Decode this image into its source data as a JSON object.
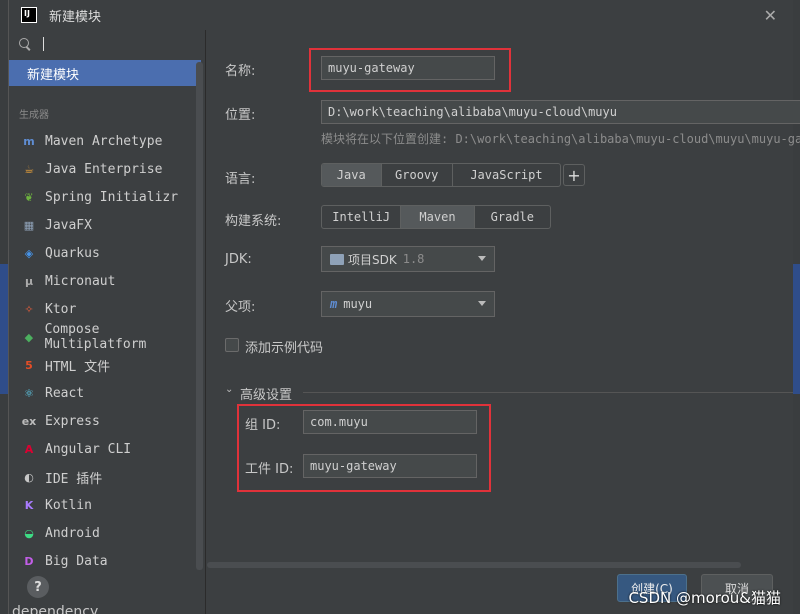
{
  "window": {
    "title": "新建模块",
    "app_icon_text": "IJ"
  },
  "sidebar": {
    "search_value": "",
    "selected": "新建模块",
    "section_label": "生成器",
    "generators": [
      {
        "label": "Maven Archetype",
        "icon": "maven-icon",
        "glyph": "m",
        "color": "#5f8dd3"
      },
      {
        "label": "Java Enterprise",
        "icon": "java-enterprise-icon",
        "glyph": "☕",
        "color": "#e8a23a"
      },
      {
        "label": "Spring Initializr",
        "icon": "spring-icon",
        "glyph": "❦",
        "color": "#6db33f"
      },
      {
        "label": "JavaFX",
        "icon": "folder-icon",
        "glyph": "▦",
        "color": "#8fa2b8"
      },
      {
        "label": "Quarkus",
        "icon": "quarkus-icon",
        "glyph": "◈",
        "color": "#4695eb"
      },
      {
        "label": "Micronaut",
        "icon": "micronaut-icon",
        "glyph": "μ",
        "color": "#aaaaaa"
      },
      {
        "label": "Ktor",
        "icon": "ktor-icon",
        "glyph": "✧",
        "color": "#e55d3b"
      },
      {
        "label": "Compose Multiplatform",
        "icon": "compose-icon",
        "glyph": "◆",
        "color": "#4cb05f"
      },
      {
        "label": "HTML 文件",
        "icon": "html5-icon",
        "glyph": "5",
        "color": "#e44d26"
      },
      {
        "label": "React",
        "icon": "react-icon",
        "glyph": "⚛",
        "color": "#61dafb"
      },
      {
        "label": "Express",
        "icon": "express-icon",
        "glyph": "ex",
        "color": "#bbbbbb"
      },
      {
        "label": "Angular CLI",
        "icon": "angular-icon",
        "glyph": "A",
        "color": "#dd0031"
      },
      {
        "label": "IDE 插件",
        "icon": "plugin-icon",
        "glyph": "◐",
        "color": "#c7c7c7"
      },
      {
        "label": "Kotlin",
        "icon": "kotlin-icon",
        "glyph": "K",
        "color": "#a97bff"
      },
      {
        "label": "Android",
        "icon": "android-icon",
        "glyph": "◒",
        "color": "#3ddc84"
      },
      {
        "label": "Big Data",
        "icon": "big-data-icon",
        "glyph": "D",
        "color": "#c25ee8"
      }
    ],
    "help": "?"
  },
  "form": {
    "name_label": "名称:",
    "name_value": "muyu-gateway",
    "location_label": "位置:",
    "location_value": "D:\\work\\teaching\\alibaba\\muyu-cloud\\muyu",
    "location_hint": "模块将在以下位置创建: D:\\work\\teaching\\alibaba\\muyu-cloud\\muyu\\muyu-ga",
    "language_label": "语言:",
    "languages": [
      "Java",
      "Groovy",
      "JavaScript"
    ],
    "language_selected": "Java",
    "add_language": "+",
    "build_label": "构建系统:",
    "build_systems": [
      "IntelliJ",
      "Maven",
      "Gradle"
    ],
    "build_selected": "Maven",
    "jdk_label": "JDK:",
    "jdk_value": "项目SDK",
    "jdk_version": "1.8",
    "parent_label": "父项:",
    "parent_value": "muyu",
    "sample_code_label": "添加示例代码",
    "advanced_label": "高级设置",
    "group_id_label": "组 ID:",
    "group_id_value": "com.muyu",
    "artifact_id_label": "工件 ID:",
    "artifact_id_value": "muyu-gateway"
  },
  "footer": {
    "create_label": "创建(C)",
    "cancel_label": "取消"
  },
  "watermark": "CSDN @morou&猫猫",
  "bottom_clipped_text": "dependency"
}
